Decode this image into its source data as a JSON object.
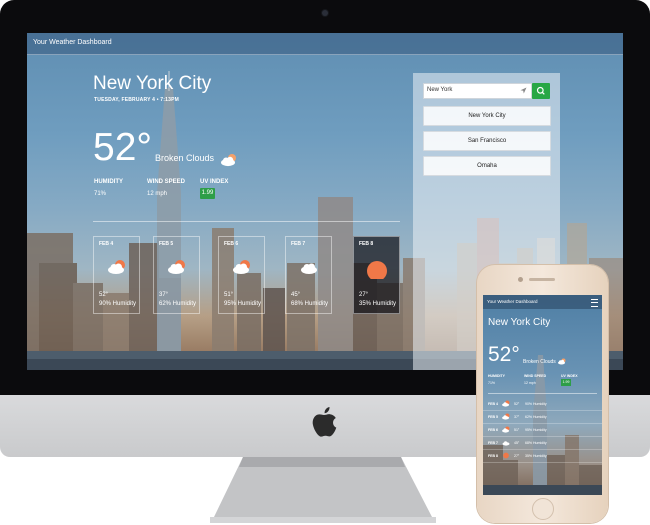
{
  "app": {
    "title": "Your Weather Dashboard"
  },
  "current": {
    "city": "New York City",
    "date": "TUESDAY, FEBRUARY 4 • 7:13PM",
    "temp": "52°",
    "condition": "Broken Clouds",
    "condition_icon": "partly-cloudy-icon",
    "humidity_label": "HUMIDITY",
    "humidity_value": "71%",
    "wind_label": "WIND SPEED",
    "wind_value": "12 mph",
    "uv_label": "UV INDEX",
    "uv_value": "1.99"
  },
  "forecast": [
    {
      "date": "FEB 4",
      "temp": "52°",
      "humidity": "90% Humidity",
      "icon": "cloud-sun-icon"
    },
    {
      "date": "FEB 5",
      "temp": "37°",
      "humidity": "62% Humidity",
      "icon": "cloud-sun-icon"
    },
    {
      "date": "FEB 6",
      "temp": "51°",
      "humidity": "95% Humidity",
      "icon": "cloud-sun-icon"
    },
    {
      "date": "FEB 7",
      "temp": "45°",
      "humidity": "68% Humidity",
      "icon": "cloud-icon"
    },
    {
      "date": "FEB 8",
      "temp": "27°",
      "humidity": "35% Humidity",
      "icon": "sun-icon"
    }
  ],
  "search": {
    "value": "New York",
    "button_icon": "search-icon"
  },
  "history": [
    "New York City",
    "San Francisco",
    "Omaha"
  ],
  "colors": {
    "accent_green": "#28a745",
    "sun_orange": "#f07848"
  }
}
